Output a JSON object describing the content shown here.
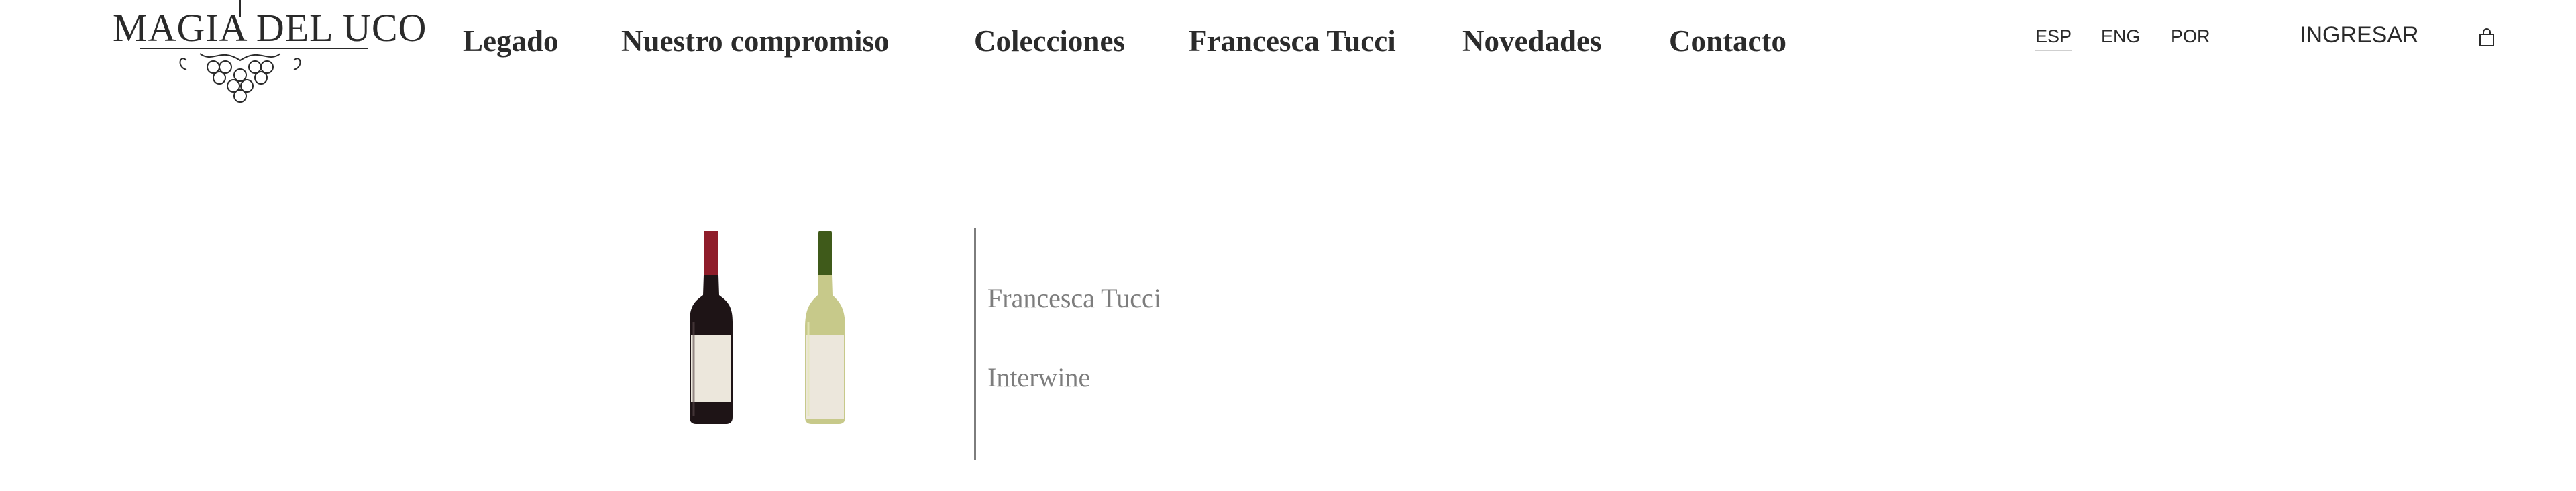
{
  "header": {
    "logo": {
      "text": "MAGIA DEL UCO"
    },
    "nav": [
      {
        "label": "Legado"
      },
      {
        "label": "Nuestro compromiso"
      },
      {
        "label": "Colecciones"
      },
      {
        "label": "Francesca Tucci"
      },
      {
        "label": "Novedades"
      },
      {
        "label": "Contacto"
      }
    ],
    "languages": [
      {
        "label": "ESP",
        "active": true
      },
      {
        "label": "ENG",
        "active": false
      },
      {
        "label": "POR",
        "active": false
      }
    ],
    "login_label": "INGRESAR",
    "cart_icon": "shopping-bag-icon"
  },
  "products": {
    "bottles": [
      {
        "icon": "red-wine-bottle",
        "capsule_color": "#8f1d2a",
        "glass_color": "#1e1416"
      },
      {
        "icon": "white-wine-bottle",
        "capsule_color": "#3f5a1a",
        "glass_color": "#c7c98a"
      }
    ]
  },
  "brands": [
    {
      "label": "Francesca Tucci"
    },
    {
      "label": "Interwine"
    }
  ],
  "colors": {
    "text": "#2a2a2a",
    "muted": "#7d7d7d",
    "divider": "#7d7d7d"
  }
}
